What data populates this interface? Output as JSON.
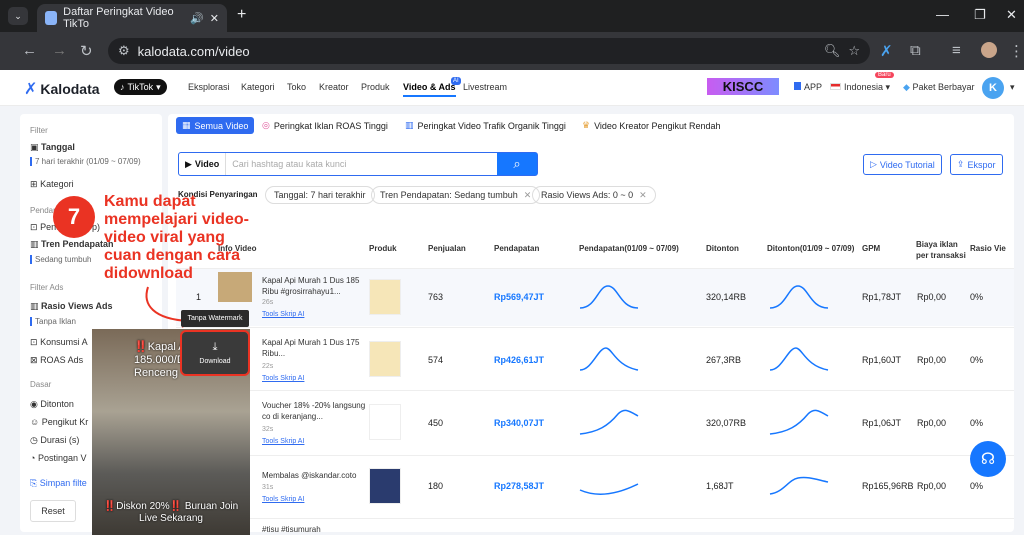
{
  "browser": {
    "tab_title": "Daftar Peringkat Video TikTo",
    "url": "kalodata.com/video"
  },
  "app": {
    "logo": "Kalodata",
    "platform": "TikTok",
    "nav": [
      "Eksplorasi",
      "Kategori",
      "Toko",
      "Kreator",
      "Produk",
      "Video & Ads",
      "Livestream"
    ],
    "ai_badge": "AI",
    "promo": "KISCC",
    "app_link": "APP",
    "region": "Indonesia",
    "region_badge": "Baru",
    "plan": "Paket Berbayar",
    "avatar": "K"
  },
  "sidebar": {
    "filter": "Filter",
    "tanggal": "Tanggal",
    "tanggal_value": "7 hari terakhir (01/09 ~ 07/09)",
    "kategori": "Kategori",
    "pendapatan_head": "Pendapat",
    "pendapatan_item": "Pend",
    "pendapatan_tail": "p)",
    "tren": "Tren Pendapatan",
    "tren_value": "Sedang tumbuh",
    "filter_ads": "Filter Ads",
    "rasio": "Rasio Views Ads",
    "rasio_value": "Tanpa Iklan",
    "konsumsi": "Konsumsi A",
    "roas": "ROAS Ads",
    "dasar": "Dasar",
    "ditonton": "Ditonton",
    "pengikut": "Pengikut Kr",
    "durasi": "Durasi (s)",
    "postingan": "Postingan V",
    "simpan": "Simpan filte",
    "reset": "Reset"
  },
  "main": {
    "tabs": [
      "Semua Video",
      "Peringkat Iklan ROAS Tinggi",
      "Peringkat Video Trafik Organik Tinggi",
      "Video Kreator Pengikut Rendah"
    ],
    "search_label": "Video",
    "search_placeholder": "Cari hashtag atau kata kunci",
    "tutorial": "Video Tutorial",
    "export": "Ekspor",
    "kondisi": "Kondisi Penyaringan",
    "chips": [
      "Tanggal: 7 hari terakhir",
      "Tren Pendapatan: Sedang tumbuh",
      "Rasio Views Ads: 0 ~ 0"
    ],
    "columns": [
      "Info Video",
      "Produk",
      "Penjualan",
      "Pendapatan",
      "Pendapatan(01/09 ~ 07/09)",
      "Ditonton",
      "Ditonton(01/09 ~ 07/09)",
      "GPM",
      "Biaya iklan per transaksi",
      "Rasio Vie"
    ]
  },
  "rows": [
    {
      "rank": "1",
      "title": "Kapal Api Murah 1 Dus 185 Ribu #grosirrahayu1...",
      "dur": "26s",
      "tools": "Tools Skrip AI",
      "sales": "763",
      "revenue": "Rp569,47JT",
      "views": "320,14RB",
      "gpm": "Rp1,78JT",
      "cost": "Rp0,00",
      "ratio": "0%"
    },
    {
      "rank": "",
      "title": "Kapal Api Murah 1 Dus 175 Ribu...",
      "dur": "22s",
      "tools": "Tools Skrip AI",
      "sales": "574",
      "revenue": "Rp426,61JT",
      "views": "267,3RB",
      "gpm": "Rp1,60JT",
      "cost": "Rp0,00",
      "ratio": "0%"
    },
    {
      "rank": "",
      "title": "Voucher 18% -20% langsung co di keranjang...",
      "dur": "32s",
      "tools": "Tools Skrip AI",
      "sales": "450",
      "revenue": "Rp340,07JT",
      "views": "320,07RB",
      "gpm": "Rp1,06JT",
      "cost": "Rp0,00",
      "ratio": "0%"
    },
    {
      "rank": "",
      "title": "Membalas @iskandar.coto",
      "dur": "31s",
      "tools": "Tools Skrip AI",
      "sales": "180",
      "revenue": "Rp278,58JT",
      "views": "1,68JT",
      "gpm": "Rp165,96RB",
      "cost": "Rp0,00",
      "ratio": "0%"
    },
    {
      "rank": "",
      "title": "#tisu #tisumurah",
      "dur": "",
      "tools": "",
      "sales": "",
      "revenue": "",
      "views": "",
      "gpm": "",
      "cost": "",
      "ratio": ""
    }
  ],
  "overlay": {
    "step": "7",
    "annotation": "Kamu dapat mempelajari video-video viral yang cuan dengan cara didownload",
    "no_watermark": "Tanpa Watermark",
    "download": "Download",
    "video_top": "‼️Kapal Api 185.000/Dus 1 Dus 12 Renceng",
    "video_bottom": "‼️Diskon 20%‼️ Buruan Join Live Sekarang"
  }
}
